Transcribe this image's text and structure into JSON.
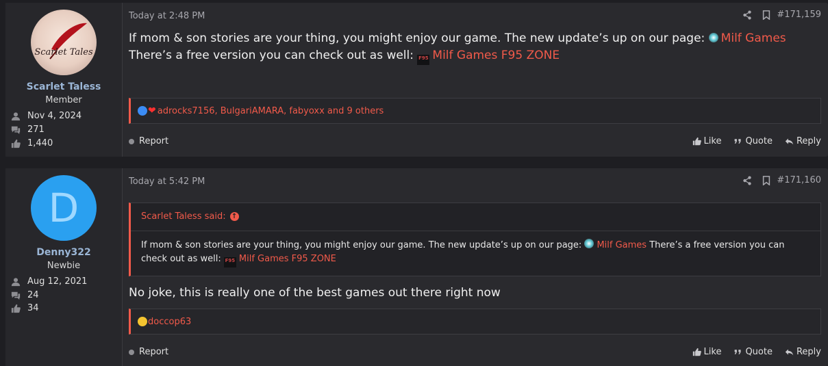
{
  "posts": [
    {
      "user": {
        "name": "Scarlet Taless",
        "role": "Member",
        "avatar_text": "Scarlet Tales",
        "joined": "Nov 4, 2024",
        "messages": "271",
        "reaction_score": "1,440"
      },
      "timestamp": "Today at 2:48 PM",
      "post_number": "#171,159",
      "body": {
        "text1": "If mom & son stories are your thing, you might enjoy our game. The new update’s up on our page:",
        "link1": "Milf Games",
        "text2": "There’s a free version you can check out as well:",
        "link2": "Milf Games F95 ZONE"
      },
      "reactions": "adrocks7156, BulgariAMARA, fabyoxx and 9 others",
      "actions": {
        "report": "Report",
        "like": "Like",
        "quote": "Quote",
        "reply": "Reply"
      }
    },
    {
      "user": {
        "name": "Denny322",
        "role": "Newbie",
        "avatar_letter": "D",
        "joined": "Aug 12, 2021",
        "messages": "24",
        "reaction_score": "34"
      },
      "timestamp": "Today at 5:42 PM",
      "post_number": "#171,160",
      "quote": {
        "author_said": "Scarlet Taless said:",
        "text1": "If mom & son stories are your thing, you might enjoy our game. The new update’s up on our page:",
        "link1": "Milf Games",
        "text2": "There’s a free version you can check out as well:",
        "link2": "Milf Games F95 ZONE"
      },
      "body": "No joke, this is really one of the best games out there right now",
      "reactions": "doccop63",
      "actions": {
        "report": "Report",
        "like": "Like",
        "quote": "Quote",
        "reply": "Reply"
      }
    }
  ],
  "icons": {
    "f95_badge": "F95"
  },
  "colors": {
    "accent": "#f15a4a",
    "username": "#9bb6d6",
    "avatar_blue": "#2aa0f0"
  }
}
